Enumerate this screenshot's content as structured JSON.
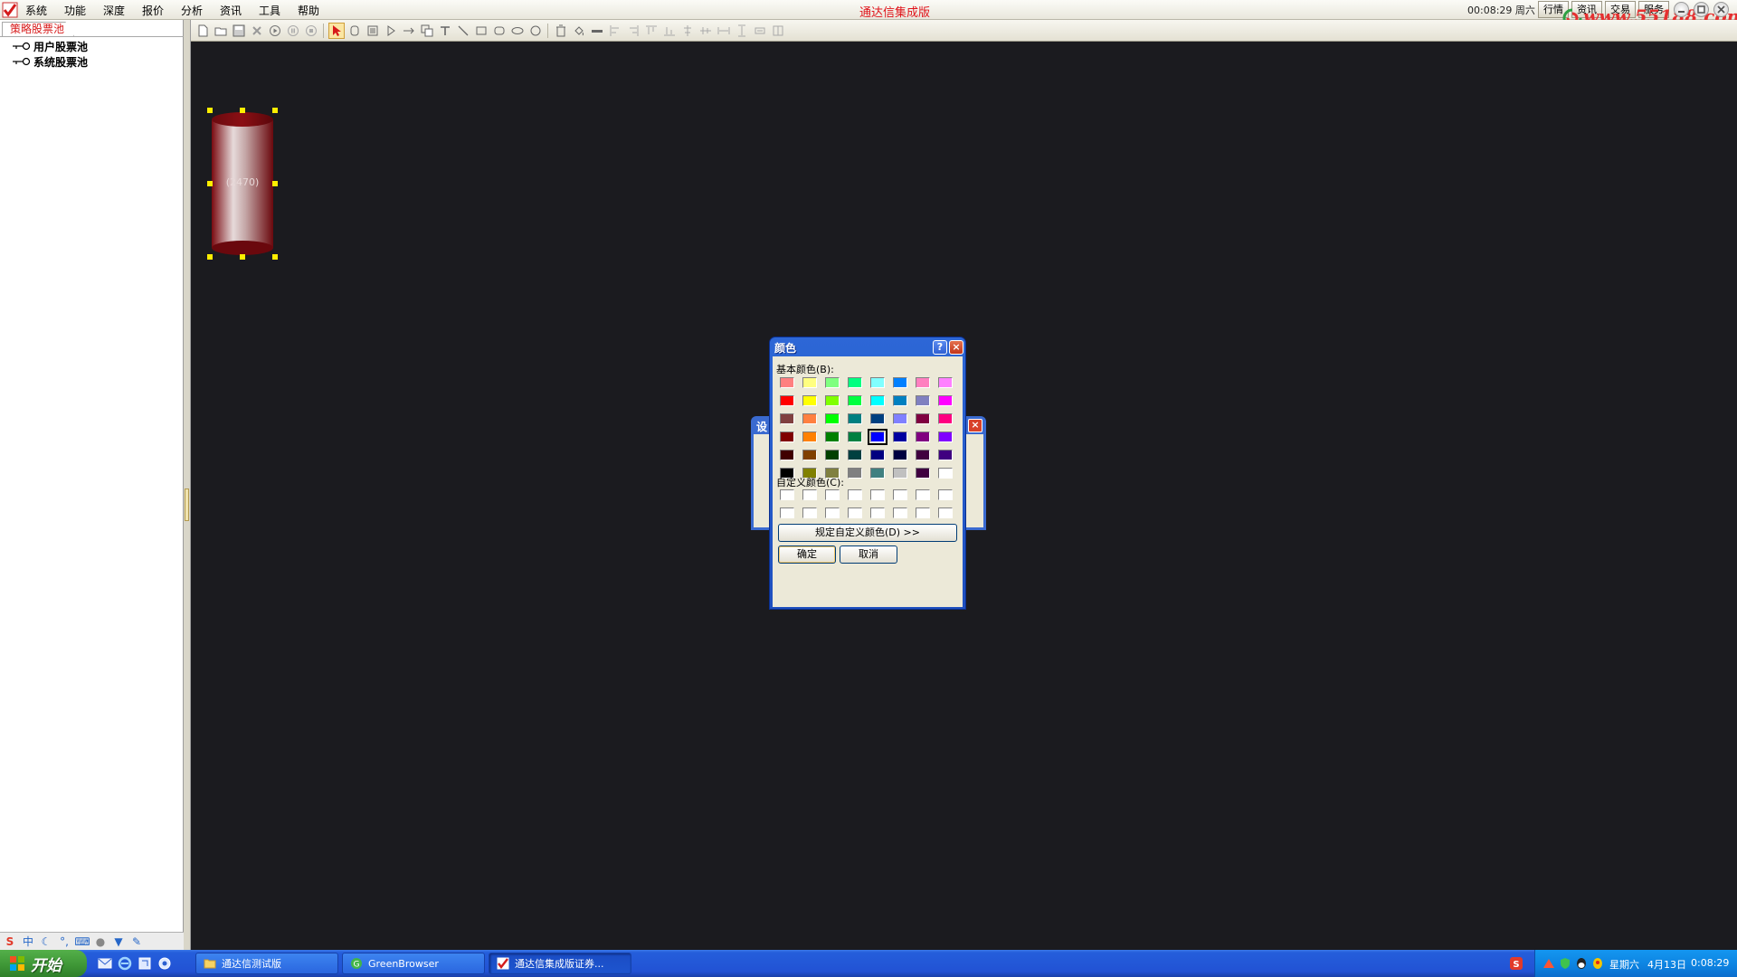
{
  "app": {
    "title": "通达信集成版",
    "clock": "00:08:29 周六",
    "watermark": "www.55188.com"
  },
  "menu": {
    "items": [
      "系统",
      "功能",
      "深度",
      "报价",
      "分析",
      "资讯",
      "工具",
      "帮助"
    ]
  },
  "top_buttons": [
    "行情",
    "资讯",
    "交易",
    "服务"
  ],
  "left_panel": {
    "tab": "策略股票池",
    "tree": [
      "用户股票池",
      "系统股票池"
    ]
  },
  "canvas": {
    "cylinder_label": "(2470)",
    "colors": {
      "background": "#1b1b1f",
      "cylinder": "#8b0f14",
      "handle": "#ffee00"
    }
  },
  "parent_dialog": {
    "caption": "设"
  },
  "color_dialog": {
    "title": "颜色",
    "help": "?",
    "close": "×",
    "basic_label": "基本颜色(B):",
    "custom_label": "自定义颜色(C):",
    "define_button": "规定自定义颜色(D) >>",
    "ok_button": "确定",
    "cancel_button": "取消",
    "selected_color": "#0000ff",
    "basic_colors": [
      [
        "#ff8080",
        "#ffff80",
        "#80ff80",
        "#00ff80",
        "#80ffff",
        "#0080ff",
        "#ff80c0",
        "#ff80ff"
      ],
      [
        "#ff0000",
        "#ffff00",
        "#80ff00",
        "#00ff40",
        "#00ffff",
        "#0080c0",
        "#8080c0",
        "#ff00ff"
      ],
      [
        "#804040",
        "#ff8040",
        "#00ff00",
        "#008080",
        "#004080",
        "#8080ff",
        "#800040",
        "#ff0080"
      ],
      [
        "#800000",
        "#ff8000",
        "#008000",
        "#008040",
        "#0000ff",
        "#0000a0",
        "#800080",
        "#8000ff"
      ],
      [
        "#400000",
        "#804000",
        "#004000",
        "#004040",
        "#000080",
        "#000040",
        "#400040",
        "#400080"
      ],
      [
        "#000000",
        "#808000",
        "#808040",
        "#808080",
        "#408080",
        "#c0c0c0",
        "#400040",
        "#ffffff"
      ]
    ]
  },
  "taskbar": {
    "start_label": "开始",
    "tasks": [
      "通达信测试版",
      "GreenBrowser",
      "通达信集成版证券..."
    ],
    "tray_day": "星期六",
    "tray_date": "4月13日",
    "tray_time": "0:08:29"
  }
}
